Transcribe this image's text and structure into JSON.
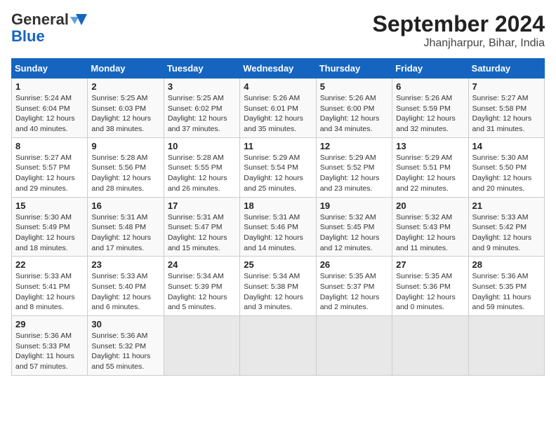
{
  "header": {
    "logo_general": "General",
    "logo_blue": "Blue",
    "title": "September 2024",
    "subtitle": "Jhanjharpur, Bihar, India"
  },
  "columns": [
    "Sunday",
    "Monday",
    "Tuesday",
    "Wednesday",
    "Thursday",
    "Friday",
    "Saturday"
  ],
  "weeks": [
    [
      {
        "day": "1",
        "info": "Sunrise: 5:24 AM\nSunset: 6:04 PM\nDaylight: 12 hours\nand 40 minutes."
      },
      {
        "day": "2",
        "info": "Sunrise: 5:25 AM\nSunset: 6:03 PM\nDaylight: 12 hours\nand 38 minutes."
      },
      {
        "day": "3",
        "info": "Sunrise: 5:25 AM\nSunset: 6:02 PM\nDaylight: 12 hours\nand 37 minutes."
      },
      {
        "day": "4",
        "info": "Sunrise: 5:26 AM\nSunset: 6:01 PM\nDaylight: 12 hours\nand 35 minutes."
      },
      {
        "day": "5",
        "info": "Sunrise: 5:26 AM\nSunset: 6:00 PM\nDaylight: 12 hours\nand 34 minutes."
      },
      {
        "day": "6",
        "info": "Sunrise: 5:26 AM\nSunset: 5:59 PM\nDaylight: 12 hours\nand 32 minutes."
      },
      {
        "day": "7",
        "info": "Sunrise: 5:27 AM\nSunset: 5:58 PM\nDaylight: 12 hours\nand 31 minutes."
      }
    ],
    [
      {
        "day": "8",
        "info": "Sunrise: 5:27 AM\nSunset: 5:57 PM\nDaylight: 12 hours\nand 29 minutes."
      },
      {
        "day": "9",
        "info": "Sunrise: 5:28 AM\nSunset: 5:56 PM\nDaylight: 12 hours\nand 28 minutes."
      },
      {
        "day": "10",
        "info": "Sunrise: 5:28 AM\nSunset: 5:55 PM\nDaylight: 12 hours\nand 26 minutes."
      },
      {
        "day": "11",
        "info": "Sunrise: 5:29 AM\nSunset: 5:54 PM\nDaylight: 12 hours\nand 25 minutes."
      },
      {
        "day": "12",
        "info": "Sunrise: 5:29 AM\nSunset: 5:52 PM\nDaylight: 12 hours\nand 23 minutes."
      },
      {
        "day": "13",
        "info": "Sunrise: 5:29 AM\nSunset: 5:51 PM\nDaylight: 12 hours\nand 22 minutes."
      },
      {
        "day": "14",
        "info": "Sunrise: 5:30 AM\nSunset: 5:50 PM\nDaylight: 12 hours\nand 20 minutes."
      }
    ],
    [
      {
        "day": "15",
        "info": "Sunrise: 5:30 AM\nSunset: 5:49 PM\nDaylight: 12 hours\nand 18 minutes."
      },
      {
        "day": "16",
        "info": "Sunrise: 5:31 AM\nSunset: 5:48 PM\nDaylight: 12 hours\nand 17 minutes."
      },
      {
        "day": "17",
        "info": "Sunrise: 5:31 AM\nSunset: 5:47 PM\nDaylight: 12 hours\nand 15 minutes."
      },
      {
        "day": "18",
        "info": "Sunrise: 5:31 AM\nSunset: 5:46 PM\nDaylight: 12 hours\nand 14 minutes."
      },
      {
        "day": "19",
        "info": "Sunrise: 5:32 AM\nSunset: 5:45 PM\nDaylight: 12 hours\nand 12 minutes."
      },
      {
        "day": "20",
        "info": "Sunrise: 5:32 AM\nSunset: 5:43 PM\nDaylight: 12 hours\nand 11 minutes."
      },
      {
        "day": "21",
        "info": "Sunrise: 5:33 AM\nSunset: 5:42 PM\nDaylight: 12 hours\nand 9 minutes."
      }
    ],
    [
      {
        "day": "22",
        "info": "Sunrise: 5:33 AM\nSunset: 5:41 PM\nDaylight: 12 hours\nand 8 minutes."
      },
      {
        "day": "23",
        "info": "Sunrise: 5:33 AM\nSunset: 5:40 PM\nDaylight: 12 hours\nand 6 minutes."
      },
      {
        "day": "24",
        "info": "Sunrise: 5:34 AM\nSunset: 5:39 PM\nDaylight: 12 hours\nand 5 minutes."
      },
      {
        "day": "25",
        "info": "Sunrise: 5:34 AM\nSunset: 5:38 PM\nDaylight: 12 hours\nand 3 minutes."
      },
      {
        "day": "26",
        "info": "Sunrise: 5:35 AM\nSunset: 5:37 PM\nDaylight: 12 hours\nand 2 minutes."
      },
      {
        "day": "27",
        "info": "Sunrise: 5:35 AM\nSunset: 5:36 PM\nDaylight: 12 hours\nand 0 minutes."
      },
      {
        "day": "28",
        "info": "Sunrise: 5:36 AM\nSunset: 5:35 PM\nDaylight: 11 hours\nand 59 minutes."
      }
    ],
    [
      {
        "day": "29",
        "info": "Sunrise: 5:36 AM\nSunset: 5:33 PM\nDaylight: 11 hours\nand 57 minutes."
      },
      {
        "day": "30",
        "info": "Sunrise: 5:36 AM\nSunset: 5:32 PM\nDaylight: 11 hours\nand 55 minutes."
      },
      {
        "day": "",
        "info": ""
      },
      {
        "day": "",
        "info": ""
      },
      {
        "day": "",
        "info": ""
      },
      {
        "day": "",
        "info": ""
      },
      {
        "day": "",
        "info": ""
      }
    ]
  ]
}
